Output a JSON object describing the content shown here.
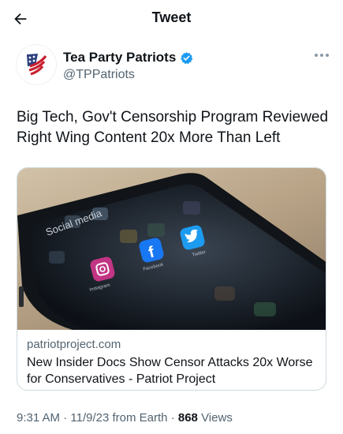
{
  "header": {
    "title": "Tweet",
    "back_icon": "arrow-left-icon"
  },
  "author": {
    "display_name": "Tea Party Patriots",
    "handle": "@TPPatriots",
    "verified_icon": "verified-badge-icon",
    "verified_color": "#1d9bf0",
    "more_icon": "more-horizontal-icon"
  },
  "tweet": {
    "text": "Big Tech, Gov't Censorship Program Reviewed Right Wing Content 20x More Than Left"
  },
  "card": {
    "image_labels": [
      "Social media",
      "Instagram",
      "Facebook",
      "Twitter"
    ],
    "domain": "patriotproject.com",
    "title": "New Insider Docs Show Censor Attacks 20x Worse for Conservatives - Patriot Project"
  },
  "meta": {
    "time": "9:31 AM",
    "date": "11/9/23",
    "source": "from Earth",
    "separator": "·",
    "views_count": "868",
    "views_label": "Views"
  },
  "colors": {
    "text_primary": "#0f1419",
    "text_secondary": "#536471",
    "accent": "#1d9bf0",
    "border": "#cfd9de"
  }
}
